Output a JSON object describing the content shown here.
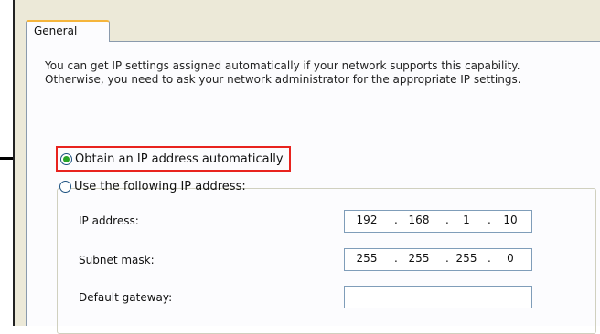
{
  "tab": {
    "label": "General"
  },
  "description": "You can get IP settings assigned automatically if your network supports this capability. Otherwise, you need to ask your network administrator for the appropriate IP settings.",
  "options": {
    "auto_label": "Obtain an IP address automatically",
    "manual_label": "Use the following IP address:",
    "selected": "auto"
  },
  "fields": {
    "ip": {
      "label": "IP address:",
      "octets": [
        "192",
        "168",
        "1",
        "10"
      ]
    },
    "subnet": {
      "label": "Subnet mask:",
      "octets": [
        "255",
        "255",
        "255",
        "0"
      ]
    },
    "gateway": {
      "label": "Default gateway:",
      "octets": [
        "",
        "",
        "",
        ""
      ]
    }
  },
  "colors": {
    "highlight": "#e8231e",
    "radio_dot": "#28a428",
    "tab_accent": "#f5b53c",
    "dialog_bg": "#ece9d8"
  }
}
